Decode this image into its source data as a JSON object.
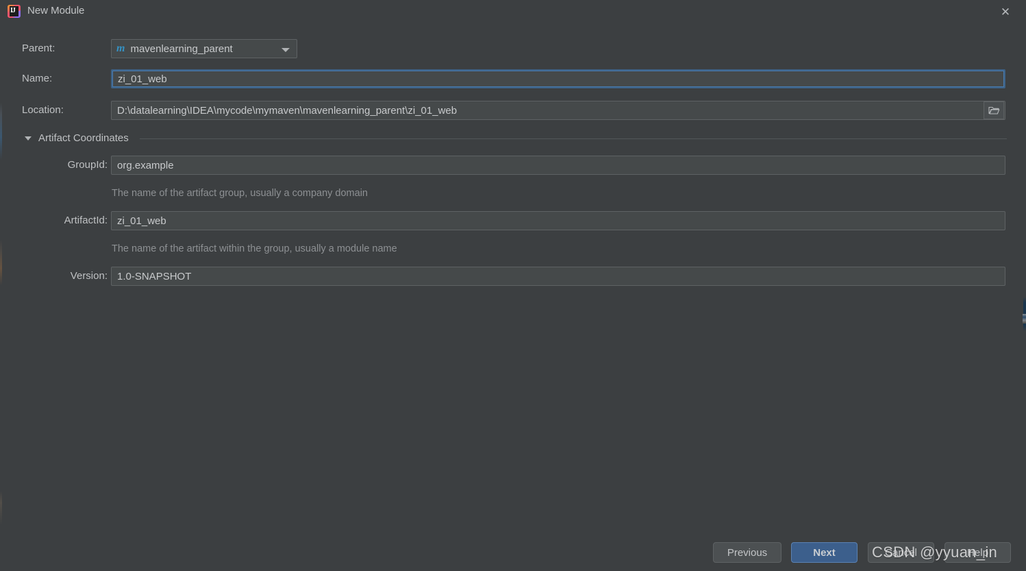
{
  "window": {
    "title": "New Module",
    "app_icon": "intellij-idea-icon",
    "icon_letters": "IJ",
    "close_label": "✕"
  },
  "form": {
    "parent": {
      "label": "Parent:",
      "value": "mavenlearning_parent",
      "icon": "maven-module-icon",
      "icon_glyph": "m",
      "icon_color": "#3592c4",
      "caret": "chevron-down-icon"
    },
    "name": {
      "label": "Name:",
      "value": "zi_01_web",
      "focused": true
    },
    "location": {
      "label": "Location:",
      "value": "D:\\datalearning\\IDEA\\mycode\\mymaven\\mavenlearning_parent\\zi_01_web",
      "browse_icon": "folder-open-icon"
    }
  },
  "artifact_coordinates": {
    "section_title": "Artifact Coordinates",
    "expanded": true,
    "toggle_icon": "triangle-down-icon",
    "group_id": {
      "label": "GroupId:",
      "value": "org.example",
      "hint": "The name of the artifact group, usually a company domain"
    },
    "artifact_id": {
      "label": "ArtifactId:",
      "value": "zi_01_web",
      "hint": "The name of the artifact within the group, usually a module name"
    },
    "version": {
      "label": "Version:",
      "value": "1.0-SNAPSHOT"
    }
  },
  "buttons": {
    "previous": "Previous",
    "next": "Next",
    "cancel": "Cancel",
    "help": "Help"
  },
  "watermark": {
    "text": "CSDN @yyuan_in"
  },
  "colors": {
    "dialog_background": "#3c3f41",
    "field_background": "#45494a",
    "field_border": "#5e6264",
    "focus_border": "#4a7cb0",
    "default_button": "#3c5f8c",
    "text_primary": "#bfc1c3",
    "text_hint": "#8d9093",
    "accent": "#3592c4"
  }
}
